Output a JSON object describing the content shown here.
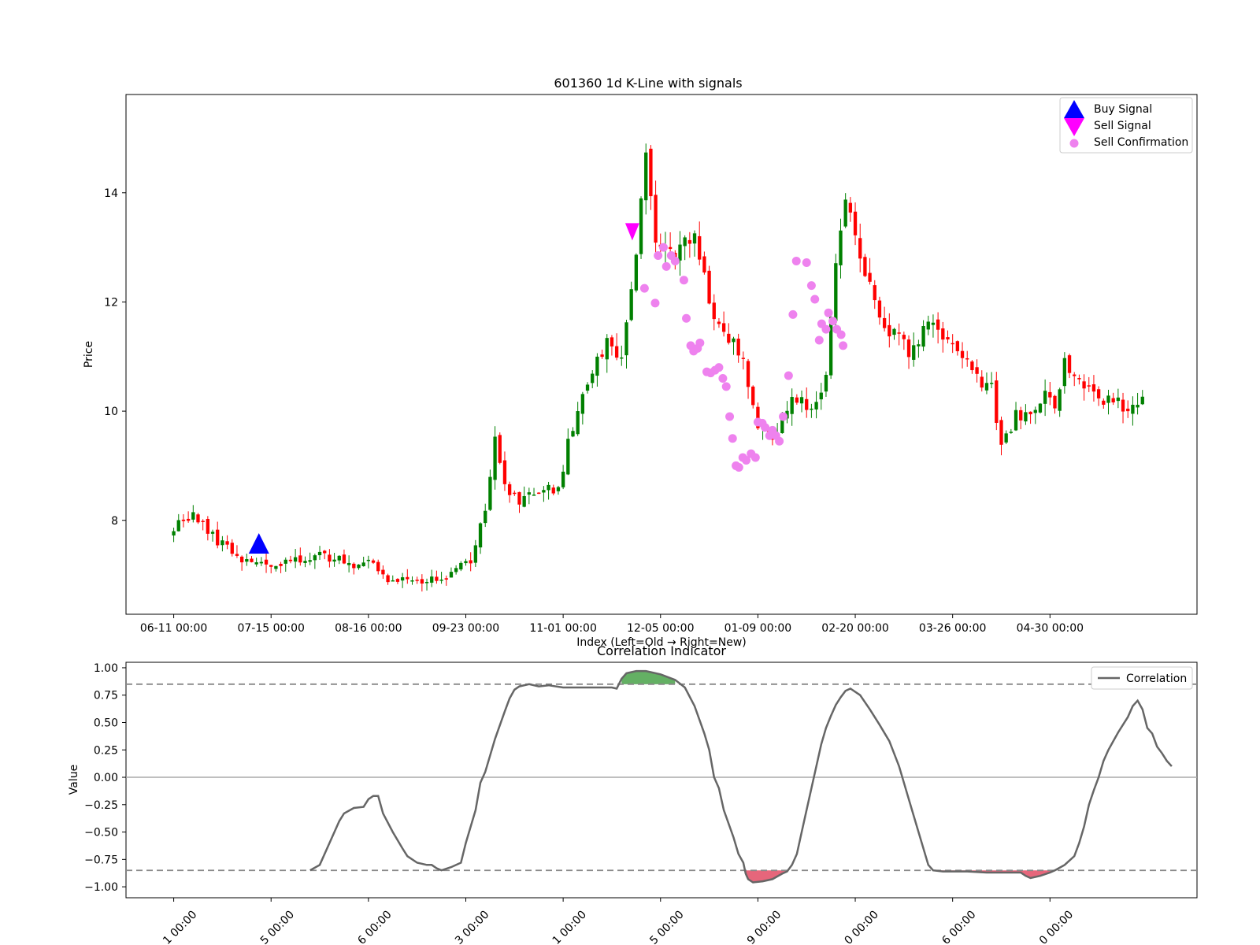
{
  "chart_data": [
    {
      "type": "candlestick",
      "title": "601360 1d K-Line with signals",
      "xlabel": "Index (Left=Old → Right=New)",
      "ylabel": "Price",
      "ylim": [
        6.28,
        15.8
      ],
      "xlim": [
        -9.8,
        210.2
      ],
      "yticks": [
        8,
        10,
        12,
        14
      ],
      "xtick_labels": [
        "06-11 00:00",
        "07-15 00:00",
        "08-16 00:00",
        "09-23 00:00",
        "11-01 00:00",
        "12-05 00:00",
        "01-09 00:00",
        "02-20 00:00",
        "03-26 00:00",
        "04-30 00:00"
      ],
      "xtick_positions": [
        0,
        20,
        40,
        60,
        80,
        100,
        120,
        140,
        160,
        180
      ],
      "legend": [
        "Buy Signal",
        "Sell Signal",
        "Sell Confirmation"
      ],
      "legend_position": "upper right",
      "colors": {
        "up": "#008000",
        "down": "#ff0000",
        "buy": "#0000ff",
        "sell": "#ff00ff",
        "confirm": "#ee82ee"
      },
      "keypoints": [
        [
          0,
          7.9
        ],
        [
          4,
          8.1
        ],
        [
          8,
          7.7
        ],
        [
          11,
          7.5
        ],
        [
          15,
          7.25
        ],
        [
          20,
          7.2
        ],
        [
          25,
          7.25
        ],
        [
          30,
          7.4
        ],
        [
          36,
          7.2
        ],
        [
          41,
          7.25
        ],
        [
          44,
          6.85
        ],
        [
          49,
          6.9
        ],
        [
          56,
          6.95
        ],
        [
          61,
          7.3
        ],
        [
          64,
          8.2
        ],
        [
          66,
          9.6
        ],
        [
          68,
          8.6
        ],
        [
          71,
          8.3
        ],
        [
          74,
          8.5
        ],
        [
          79,
          8.6
        ],
        [
          81,
          9.4
        ],
        [
          84,
          10.4
        ],
        [
          89,
          11.3
        ],
        [
          92,
          11.0
        ],
        [
          95,
          12.8
        ],
        [
          97,
          14.9
        ],
        [
          99,
          13.0
        ],
        [
          103,
          12.9
        ],
        [
          107,
          13.2
        ],
        [
          110,
          12.0
        ],
        [
          113,
          11.5
        ],
        [
          117,
          10.9
        ],
        [
          120,
          9.7
        ],
        [
          123,
          9.5
        ],
        [
          127,
          10.2
        ],
        [
          131,
          10.1
        ],
        [
          134,
          10.6
        ],
        [
          136,
          12.8
        ],
        [
          138,
          13.9
        ],
        [
          141,
          12.8
        ],
        [
          145,
          11.7
        ],
        [
          148,
          11.4
        ],
        [
          151,
          11.1
        ],
        [
          155,
          11.6
        ],
        [
          159,
          11.4
        ],
        [
          161,
          11.1
        ],
        [
          164,
          10.7
        ],
        [
          168,
          10.4
        ],
        [
          170,
          9.3
        ],
        [
          173,
          9.9
        ],
        [
          176,
          9.9
        ],
        [
          179,
          10.3
        ],
        [
          181,
          10.1
        ],
        [
          183,
          10.9
        ],
        [
          186,
          10.5
        ],
        [
          190,
          10.2
        ],
        [
          196,
          10.1
        ],
        [
          199,
          10.3
        ]
      ],
      "buy_signals": [
        {
          "x": 17.5,
          "y": 7.55
        }
      ],
      "sell_signals": [
        {
          "x": 94.2,
          "y": 13.3
        }
      ],
      "sell_confirmations": [
        [
          96.7,
          12.25
        ],
        [
          98.9,
          11.98
        ],
        [
          99.5,
          12.85
        ],
        [
          100.6,
          13.0
        ],
        [
          101.2,
          12.65
        ],
        [
          102.2,
          12.85
        ],
        [
          103.0,
          12.75
        ],
        [
          104.8,
          12.4
        ],
        [
          105.3,
          11.7
        ],
        [
          106.2,
          11.2
        ],
        [
          106.8,
          11.1
        ],
        [
          107.6,
          11.15
        ],
        [
          108.1,
          11.25
        ],
        [
          109.5,
          10.72
        ],
        [
          110.3,
          10.7
        ],
        [
          111.2,
          10.75
        ],
        [
          112.0,
          10.8
        ],
        [
          112.8,
          10.6
        ],
        [
          113.5,
          10.45
        ],
        [
          114.2,
          9.9
        ],
        [
          114.8,
          9.5
        ],
        [
          115.5,
          9.0
        ],
        [
          116.1,
          8.97
        ],
        [
          116.9,
          9.15
        ],
        [
          117.6,
          9.1
        ],
        [
          118.6,
          9.22
        ],
        [
          119.5,
          9.15
        ],
        [
          120.0,
          9.8
        ],
        [
          120.9,
          9.78
        ],
        [
          121.5,
          9.7
        ],
        [
          122.4,
          9.55
        ],
        [
          123.0,
          9.65
        ],
        [
          123.7,
          9.55
        ],
        [
          124.4,
          9.45
        ],
        [
          125.2,
          9.9
        ],
        [
          126.3,
          10.65
        ],
        [
          127.2,
          11.77
        ],
        [
          127.9,
          12.75
        ],
        [
          130.0,
          12.72
        ],
        [
          131.0,
          12.3
        ],
        [
          131.7,
          12.05
        ],
        [
          132.6,
          11.3
        ],
        [
          133.1,
          11.6
        ],
        [
          134.0,
          11.5
        ],
        [
          134.5,
          11.8
        ],
        [
          135.4,
          11.65
        ],
        [
          136.2,
          11.5
        ],
        [
          137.1,
          11.4
        ],
        [
          137.5,
          11.2
        ]
      ]
    },
    {
      "type": "line",
      "title": "Correlation Indicator",
      "ylabel": "Value",
      "ylim": [
        -1.1,
        1.05
      ],
      "yticks": [
        -1.0,
        -0.75,
        -0.5,
        -0.25,
        0.0,
        0.25,
        0.5,
        0.75,
        1.0
      ],
      "ytick_labels": [
        "−1.00",
        "−0.75",
        "−0.50",
        "−0.25",
        "0.00",
        "0.25",
        "0.50",
        "0.75",
        "1.00"
      ],
      "thresholds": [
        0.85,
        -0.85
      ],
      "xtick_labels": [
        "1 00:00",
        "5 00:00",
        "6 00:00",
        "3 00:00",
        "1 00:00",
        "5 00:00",
        "9 00:00",
        "0 00:00",
        "6 00:00",
        "0 00:00"
      ],
      "legend": [
        "Correlation"
      ],
      "legend_position": "upper right",
      "colors": {
        "line": "#666666",
        "positive_fill": "#3d9c3d",
        "negative_fill": "#e0405a",
        "threshold": "#888888"
      },
      "series": [
        {
          "name": "Correlation",
          "points": [
            [
              28,
              -0.85
            ],
            [
              30,
              -0.8
            ],
            [
              32,
              -0.6
            ],
            [
              33,
              -0.5
            ],
            [
              34,
              -0.4
            ],
            [
              35,
              -0.33
            ],
            [
              37,
              -0.28
            ],
            [
              39,
              -0.27
            ],
            [
              40,
              -0.2
            ],
            [
              41,
              -0.17
            ],
            [
              42,
              -0.17
            ],
            [
              43,
              -0.33
            ],
            [
              45,
              -0.5
            ],
            [
              47,
              -0.65
            ],
            [
              48,
              -0.72
            ],
            [
              50,
              -0.78
            ],
            [
              52,
              -0.8
            ],
            [
              53,
              -0.8
            ],
            [
              54,
              -0.83
            ],
            [
              55,
              -0.85
            ],
            [
              57,
              -0.82
            ],
            [
              59,
              -0.78
            ],
            [
              60,
              -0.6
            ],
            [
              62,
              -0.3
            ],
            [
              63,
              -0.05
            ],
            [
              64,
              0.05
            ],
            [
              65,
              0.2
            ],
            [
              66,
              0.35
            ],
            [
              68,
              0.6
            ],
            [
              69,
              0.72
            ],
            [
              70,
              0.8
            ],
            [
              71,
              0.83
            ],
            [
              73,
              0.85
            ],
            [
              75,
              0.83
            ],
            [
              77,
              0.84
            ],
            [
              80,
              0.82
            ],
            [
              84,
              0.82
            ],
            [
              87,
              0.82
            ],
            [
              90,
              0.82
            ],
            [
              91,
              0.81
            ],
            [
              92,
              0.9
            ],
            [
              93,
              0.95
            ],
            [
              95,
              0.97
            ],
            [
              97,
              0.97
            ],
            [
              100,
              0.94
            ],
            [
              103,
              0.89
            ],
            [
              105,
              0.82
            ],
            [
              107,
              0.65
            ],
            [
              109,
              0.4
            ],
            [
              110,
              0.25
            ],
            [
              111,
              0.0
            ],
            [
              112,
              -0.1
            ],
            [
              113,
              -0.3
            ],
            [
              115,
              -0.55
            ],
            [
              116,
              -0.7
            ],
            [
              117,
              -0.78
            ],
            [
              117.5,
              -0.88
            ],
            [
              118,
              -0.93
            ],
            [
              119,
              -0.96
            ],
            [
              121,
              -0.95
            ],
            [
              123,
              -0.93
            ],
            [
              125,
              -0.88
            ],
            [
              126,
              -0.86
            ],
            [
              127,
              -0.8
            ],
            [
              128,
              -0.7
            ],
            [
              129,
              -0.5
            ],
            [
              130,
              -0.3
            ],
            [
              131,
              -0.1
            ],
            [
              132,
              0.1
            ],
            [
              133,
              0.3
            ],
            [
              134,
              0.45
            ],
            [
              135,
              0.56
            ],
            [
              136,
              0.66
            ],
            [
              137,
              0.73
            ],
            [
              138,
              0.79
            ],
            [
              139,
              0.81
            ],
            [
              141,
              0.75
            ],
            [
              143,
              0.62
            ],
            [
              145,
              0.48
            ],
            [
              147,
              0.33
            ],
            [
              149,
              0.1
            ],
            [
              151,
              -0.2
            ],
            [
              153,
              -0.5
            ],
            [
              155,
              -0.8
            ],
            [
              156,
              -0.85
            ],
            [
              158,
              -0.86
            ],
            [
              163,
              -0.86
            ],
            [
              167,
              -0.87
            ],
            [
              171,
              -0.87
            ],
            [
              174,
              -0.87
            ],
            [
              175,
              -0.9
            ],
            [
              176,
              -0.92
            ],
            [
              178,
              -0.9
            ],
            [
              180,
              -0.87
            ],
            [
              181,
              -0.85
            ],
            [
              183,
              -0.8
            ],
            [
              185,
              -0.72
            ],
            [
              186,
              -0.6
            ],
            [
              187,
              -0.45
            ],
            [
              188,
              -0.25
            ],
            [
              189,
              -0.12
            ],
            [
              190,
              0.0
            ],
            [
              191,
              0.15
            ],
            [
              192,
              0.25
            ],
            [
              193,
              0.33
            ],
            [
              194,
              0.41
            ],
            [
              195,
              0.48
            ],
            [
              196,
              0.55
            ],
            [
              197,
              0.65
            ],
            [
              198,
              0.7
            ],
            [
              199,
              0.62
            ],
            [
              200,
              0.45
            ],
            [
              201,
              0.4
            ],
            [
              202,
              0.28
            ],
            [
              203,
              0.22
            ],
            [
              204,
              0.15
            ],
            [
              205,
              0.1
            ]
          ]
        }
      ]
    }
  ]
}
